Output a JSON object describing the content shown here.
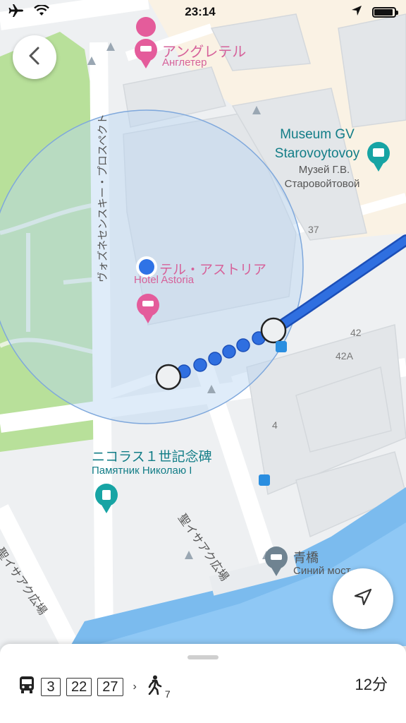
{
  "status_bar": {
    "time": "23:14"
  },
  "map": {
    "places": {
      "hotel_angleterre": {
        "name_ja": "アングレテル",
        "name_local": "Англетер"
      },
      "museum": {
        "name_line1": "Museum GV",
        "name_line2": "Starovoytovoy",
        "local_line1": "Музей Г.В.",
        "local_line2": "Старовойтовой"
      },
      "hotel_astoria": {
        "name_ja": "テル・アストリア",
        "name_local": "Hotel Astoria"
      },
      "monument": {
        "name_ja": "ニコラス１世記念碑",
        "name_local": "Памятник Николаю I"
      },
      "blue_bridge": {
        "name_ja": "青橋",
        "name_local": "Синий мост"
      }
    },
    "street_labels": {
      "voznesensky": "ヴォズネセンスキー・プロスペクト",
      "isaac_square_1": "聖イサアク広場",
      "isaac_square_2": "聖イサアク広場"
    },
    "building_numbers": [
      "37",
      "42",
      "42A",
      "4"
    ]
  },
  "bottom_sheet": {
    "bus_routes": [
      "3",
      "22",
      "27"
    ],
    "walk_minutes": "7",
    "duration": "12分"
  },
  "colors": {
    "route": "#2f6fe0",
    "accuracy_circle": "#b9d4f1",
    "park": "#b8e09a",
    "water": "#8fc8f5"
  }
}
